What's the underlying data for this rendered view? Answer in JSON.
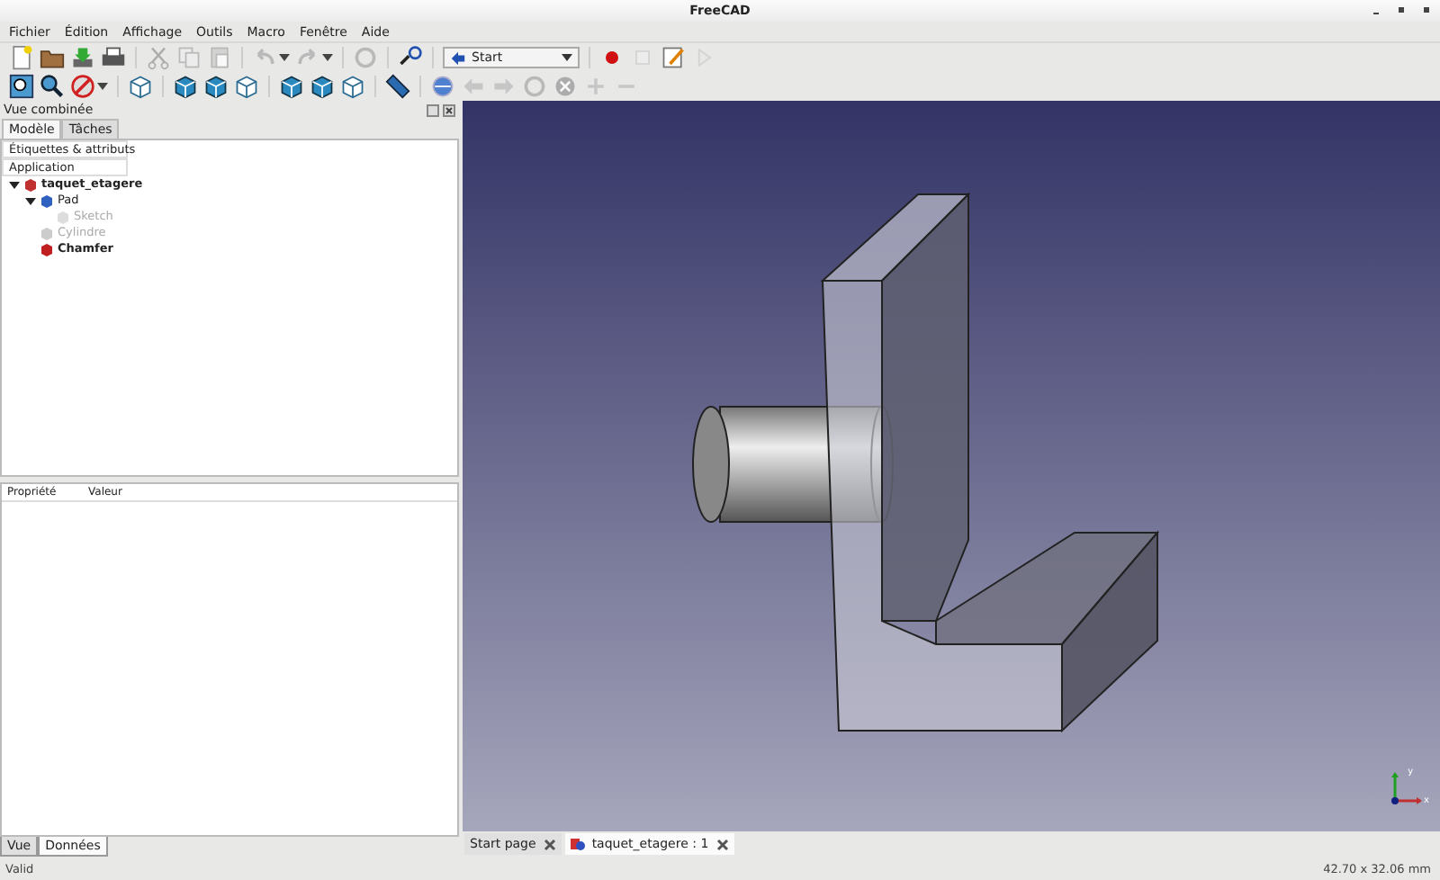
{
  "window": {
    "title": "FreeCAD"
  },
  "menu": [
    "Fichier",
    "Édition",
    "Affichage",
    "Outils",
    "Macro",
    "Fenêtre",
    "Aide"
  ],
  "workbench": {
    "value": "Start"
  },
  "combo_view": {
    "title": "Vue combinée",
    "tabs": [
      {
        "label": "Modèle",
        "selected": true
      },
      {
        "label": "Tâches",
        "selected": false
      }
    ],
    "tree_header": "Étiquettes & attributs",
    "tree_root": "Application",
    "tree": [
      {
        "label": "taquet_etagere",
        "kind": "document",
        "expanded": true,
        "bold": true,
        "visible": true,
        "children": [
          {
            "label": "Pad",
            "kind": "pad",
            "expanded": true,
            "bold": false,
            "visible": true,
            "children": [
              {
                "label": "Sketch",
                "kind": "sketch",
                "bold": false,
                "visible": false
              }
            ]
          },
          {
            "label": "Cylindre",
            "kind": "cylinder",
            "bold": false,
            "visible": false
          },
          {
            "label": "Chamfer",
            "kind": "chamfer",
            "bold": true,
            "visible": true
          }
        ]
      }
    ]
  },
  "properties": {
    "columns": [
      "Propriété",
      "Valeur"
    ],
    "tabs": [
      {
        "label": "Vue",
        "selected": false
      },
      {
        "label": "Données",
        "selected": true
      }
    ]
  },
  "view3d": {
    "axes": {
      "y": "y",
      "x": "x"
    }
  },
  "doc_tabs": [
    {
      "label": "Start page",
      "selected": false,
      "kind": "start"
    },
    {
      "label": "taquet_etagere : 1",
      "selected": true,
      "kind": "document"
    }
  ],
  "status_bar": {
    "message": "Valid",
    "dimensions": "42.70 x 32.06 mm"
  }
}
